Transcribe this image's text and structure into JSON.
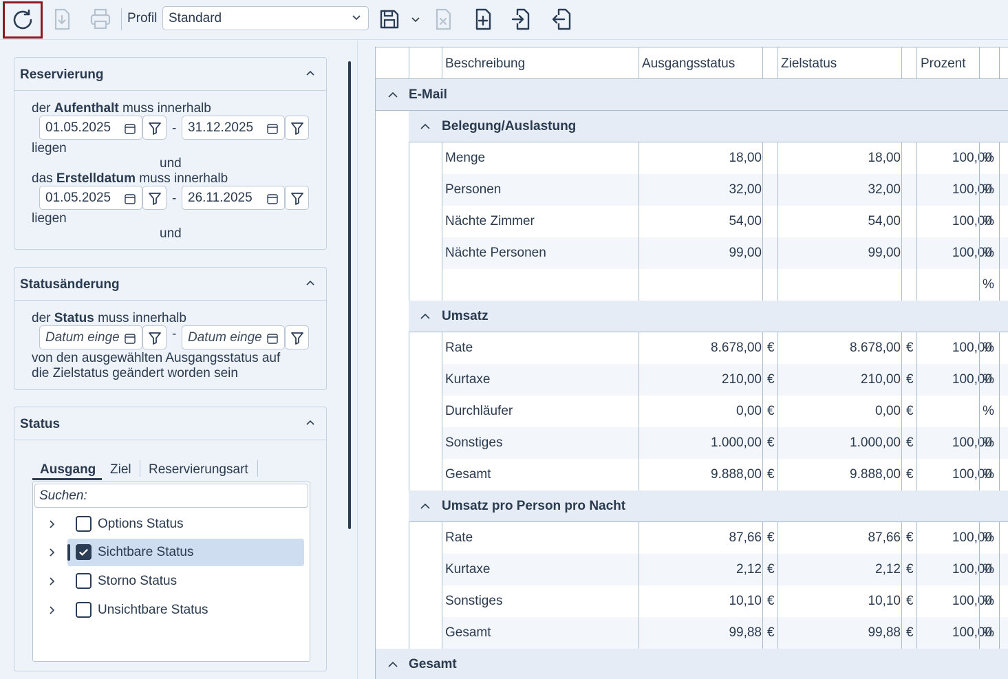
{
  "toolbar": {
    "profile_label": "Profil",
    "profile_value": "Standard"
  },
  "reservierung": {
    "title": "Reservierung",
    "line1_pre": "der",
    "line1_bold": "Aufenthalt",
    "line1_post": "muss innerhalb",
    "date_from": "01.05.2025",
    "date_to": "31.12.2025",
    "liegen1": "liegen",
    "und1": "und",
    "line2_pre": "das",
    "line2_bold": "Erstelldatum",
    "line2_post": "muss innerhalb",
    "date2_from": "01.05.2025",
    "date2_to": "26.11.2025",
    "liegen2": "liegen",
    "und2": "und",
    "dash": "-"
  },
  "statusaenderung": {
    "title": "Statusänderung",
    "line_pre": "der",
    "line_bold": "Status",
    "line_post": "muss innerhalb",
    "date_from_placeholder": "Datum einge",
    "date_to_placeholder": "Datum einge",
    "desc1": "von den ausgewählten Ausgangsstatus auf",
    "desc2": "die Zielstatus geändert worden sein"
  },
  "status": {
    "title": "Status",
    "tabs": [
      "Ausgang",
      "Ziel",
      "Reservierungsart"
    ],
    "search_placeholder": "Suchen:",
    "items": [
      {
        "label": "Options Status",
        "checked": false
      },
      {
        "label": "Sichtbare Status",
        "checked": true
      },
      {
        "label": "Storno Status",
        "checked": false
      },
      {
        "label": "Unsichtbare Status",
        "checked": false
      }
    ]
  },
  "grid": {
    "headers": {
      "beschreibung": "Beschreibung",
      "ausgangsstatus": "Ausgangsstatus",
      "zielstatus": "Zielstatus",
      "prozent": "Prozent"
    },
    "group_main": "E-Mail",
    "sections": [
      {
        "title": "Belegung/Auslastung",
        "rows": [
          {
            "desc": "Menge",
            "a": "18,00",
            "au": "",
            "z": "18,00",
            "zu": "",
            "p": "100,00",
            "pu": "%"
          },
          {
            "desc": "Personen",
            "a": "32,00",
            "au": "",
            "z": "32,00",
            "zu": "",
            "p": "100,00",
            "pu": "%"
          },
          {
            "desc": "Nächte Zimmer",
            "a": "54,00",
            "au": "",
            "z": "54,00",
            "zu": "",
            "p": "100,00",
            "pu": "%"
          },
          {
            "desc": "Nächte Personen",
            "a": "99,00",
            "au": "",
            "z": "99,00",
            "zu": "",
            "p": "100,00",
            "pu": "%"
          },
          {
            "desc": "",
            "a": "",
            "au": "",
            "z": "",
            "zu": "",
            "p": "",
            "pu": "%"
          }
        ]
      },
      {
        "title": "Umsatz",
        "rows": [
          {
            "desc": "Rate",
            "a": "8.678,00",
            "au": "€",
            "z": "8.678,00",
            "zu": "€",
            "p": "100,00",
            "pu": "%"
          },
          {
            "desc": "Kurtaxe",
            "a": "210,00",
            "au": "€",
            "z": "210,00",
            "zu": "€",
            "p": "100,00",
            "pu": "%"
          },
          {
            "desc": "Durchläufer",
            "a": "0,00",
            "au": "€",
            "z": "0,00",
            "zu": "€",
            "p": "",
            "pu": "%"
          },
          {
            "desc": "Sonstiges",
            "a": "1.000,00",
            "au": "€",
            "z": "1.000,00",
            "zu": "€",
            "p": "100,00",
            "pu": "%"
          },
          {
            "desc": "Gesamt",
            "a": "9.888,00",
            "au": "€",
            "z": "9.888,00",
            "zu": "€",
            "p": "100,00",
            "pu": "%"
          }
        ]
      },
      {
        "title": "Umsatz pro Person pro Nacht",
        "rows": [
          {
            "desc": "Rate",
            "a": "87,66",
            "au": "€",
            "z": "87,66",
            "zu": "€",
            "p": "100,00",
            "pu": "%"
          },
          {
            "desc": "Kurtaxe",
            "a": "2,12",
            "au": "€",
            "z": "2,12",
            "zu": "€",
            "p": "100,00",
            "pu": "%"
          },
          {
            "desc": "Sonstiges",
            "a": "10,10",
            "au": "€",
            "z": "10,10",
            "zu": "€",
            "p": "100,00",
            "pu": "%"
          },
          {
            "desc": "Gesamt",
            "a": "99,88",
            "au": "€",
            "z": "99,88",
            "zu": "€",
            "p": "100,00",
            "pu": "%"
          }
        ]
      }
    ],
    "group_total": "Gesamt"
  }
}
